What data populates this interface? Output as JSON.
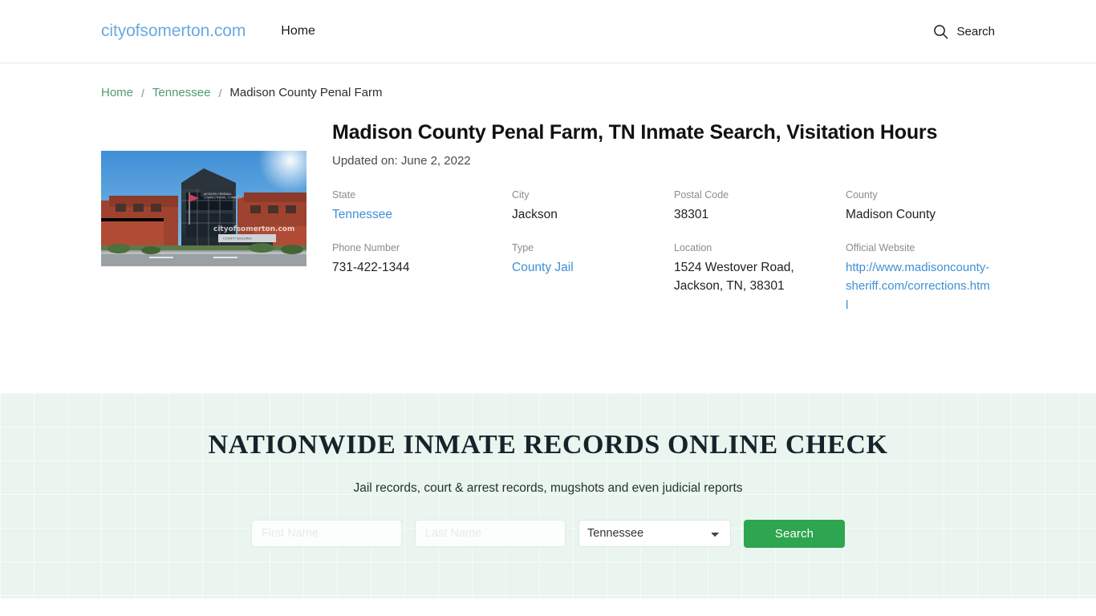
{
  "header": {
    "brand": "cityofsomerton.com",
    "nav": [
      {
        "label": "Home"
      }
    ],
    "search_label": "Search",
    "search_icon": "search-icon"
  },
  "breadcrumb": {
    "items": [
      {
        "label": "Home",
        "link": true
      },
      {
        "label": "Tennessee",
        "link": true
      },
      {
        "label": "Madison County Penal Farm",
        "link": false
      }
    ],
    "separator": "/"
  },
  "article": {
    "title": "Madison County Penal Farm, TN Inmate Search, Visitation Hours",
    "updated": "Updated on: June 2, 2022",
    "photo_alt": "Madison County Penal Farm building",
    "photo_watermark": "cityofsomerton.com",
    "photo_sign": "COUNTY BUILDING",
    "photo_banner": "CRIMINAL JUSTICE CORRECTIONAL COMPLEX",
    "details": [
      {
        "label": "State",
        "value": "Tennessee",
        "style": "link"
      },
      {
        "label": "City",
        "value": "Jackson",
        "style": "plain"
      },
      {
        "label": "Postal Code",
        "value": "38301",
        "style": "plain"
      },
      {
        "label": "County",
        "value": "Madison County",
        "style": "plain"
      },
      {
        "label": "Phone Number",
        "value": "731-422-1344",
        "style": "plain"
      },
      {
        "label": "Type",
        "value": "County Jail",
        "style": "link"
      },
      {
        "label": "Location",
        "value": "1524 Westover Road, Jackson, TN, 38301",
        "style": "plain"
      },
      {
        "label": "Official Website",
        "value": "http://www.madisoncounty-sheriff.com/corrections.html",
        "style": "url"
      }
    ]
  },
  "promo": {
    "title": "NATIONWIDE INMATE RECORDS ONLINE CHECK",
    "subtitle": "Jail records, court & arrest records, mugshots and even judicial reports",
    "first_name_placeholder": "First Name",
    "first_name_value": "",
    "last_name_placeholder": "Last Name",
    "last_name_value": "",
    "state_selected": "Tennessee",
    "state_options": [
      "Tennessee"
    ],
    "search_button": "Search"
  },
  "colors": {
    "brand_blue": "#6aa9e0",
    "link_blue": "#3e8fd4",
    "breadcrumb_green": "#4f9a70",
    "button_green": "#2ea54f",
    "promo_bg": "#e9f5ee",
    "label_gray": "#8c8c8c"
  }
}
